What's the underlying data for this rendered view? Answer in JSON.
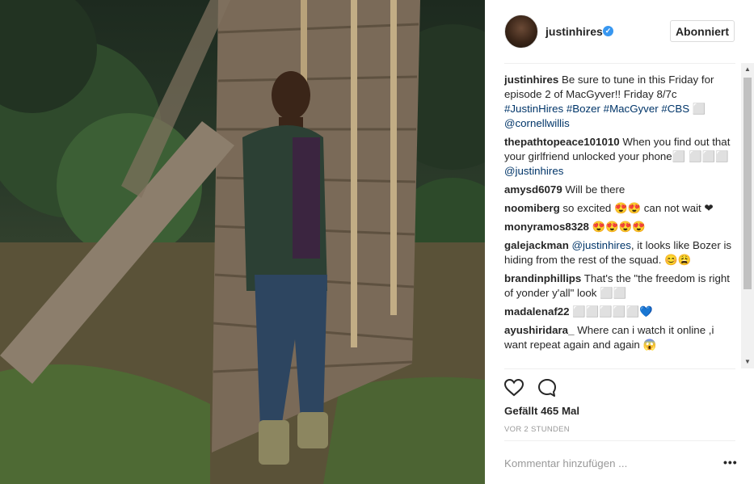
{
  "photo": {
    "alt_subject": "man-leaning-on-wooden-wall"
  },
  "post": {
    "username": "justinhires",
    "follow_label": "Abonniert",
    "likes_label": "Gefällt 465 Mal",
    "time_label": "VOR 2 STUNDEN",
    "comment_placeholder": "Kommentar hinzufügen ...",
    "more_label": "•••"
  },
  "comments": [
    {
      "author": "justinhires",
      "text": "Be sure to tune in this Friday for episode 2 of MacGyver!! Friday 8/7c",
      "tags": "#JustinHires #Bozer #MacGyver #CBS ⬜",
      "mention": "@cornellwillis"
    },
    {
      "author": "thepathtopeace101010",
      "text": "When you find out that your girlfriend unlocked your phone⬜ ⬜⬜⬜",
      "mention": "@justinhires"
    },
    {
      "author": "amysd6079",
      "text": "Will be there"
    },
    {
      "author": "noomiberg",
      "text": "so excited 😍😍 can not wait ❤"
    },
    {
      "author": "monyramos8328",
      "text": "😍😍😍😍"
    },
    {
      "author": "galejackman",
      "mention": "@justinhires",
      "text": ", it looks like Bozer is hiding from the rest of the squad. 😊😩"
    },
    {
      "author": "brandinphillips",
      "text": "That's the \"the freedom is right of yonder y'all\" look ⬜⬜"
    },
    {
      "author": "madalenaf22",
      "text": "⬜⬜⬜⬜⬜💙"
    },
    {
      "author": "ayushiridara_",
      "text": "Where can i watch it online ,i want repeat again and again 😱"
    }
  ],
  "scrollbar": {
    "up": "▲",
    "down": "▼"
  },
  "colors": {
    "verified": "#3897f0",
    "link": "#003569",
    "muted": "#999999"
  },
  "icons": {
    "like": "heart-icon",
    "comment": "comment-bubble-icon",
    "verified": "verified-badge-icon",
    "more": "ellipsis-icon"
  }
}
